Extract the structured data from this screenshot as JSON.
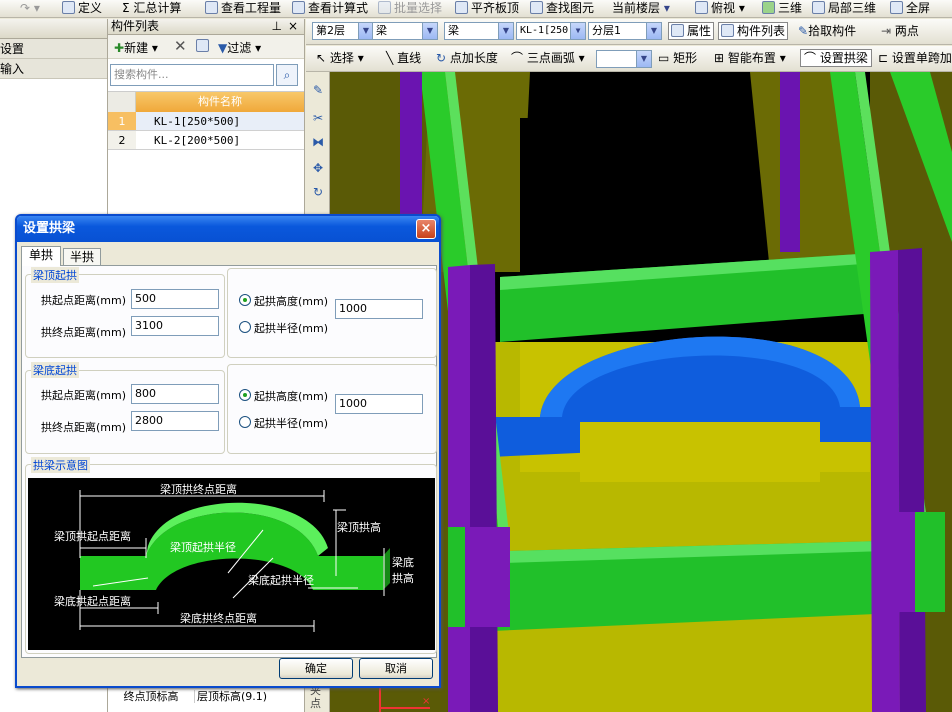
{
  "top_toolbar": {
    "items": [
      "定义",
      "Σ 汇总计算",
      "查看工程量",
      "查看计算式",
      "批量选择",
      "平齐板顶",
      "查找图元",
      "当前楼层",
      "俯视",
      "三维",
      "局部三维",
      "全屏"
    ]
  },
  "left_panel": {
    "items": [
      "设置",
      "输入"
    ]
  },
  "component_list": {
    "title": "构件列表",
    "pin": "ᵖ",
    "close": "×",
    "new_label": "新建",
    "filter_label": "过滤",
    "search_placeholder": "搜索构件...",
    "column_header": "构件名称",
    "rows": [
      {
        "num": "1",
        "name": "KL-1[250*500]"
      },
      {
        "num": "2",
        "name": "KL-2[200*500]"
      }
    ]
  },
  "selectors": {
    "floor": "第2层",
    "type1": "梁",
    "type2": "梁",
    "component": "KL-1[250",
    "layer": "分层1"
  },
  "toolbar2": {
    "properties": "属性",
    "component_list": "构件列表",
    "pick_component": "拾取构件",
    "two_points": "两点"
  },
  "toolbar3": {
    "select": "选择",
    "line": "直线",
    "point_length": "点加长度",
    "three_point_arc": "三点画弧",
    "rectangle": "矩形",
    "smart_layout": "智能布置",
    "set_arch_beam": "设置拱梁",
    "set_single_span": "设置单跨加"
  },
  "bottom_props": {
    "label": "终点顶标高",
    "value": "层顶标高(9.1)",
    "side_text": "夹点"
  },
  "dialog": {
    "title": "设置拱梁",
    "close": "×",
    "tabs": [
      "单拱",
      "半拱"
    ],
    "top_group": {
      "title": "梁顶起拱",
      "start_label": "拱起点距离(mm)",
      "start_value": "500",
      "end_label": "拱终点距离(mm)",
      "end_value": "3100",
      "height_label": "起拱高度(mm)",
      "radius_label": "起拱半径(mm)",
      "height_value": "1000"
    },
    "bottom_group": {
      "title": "梁底起拱",
      "start_label": "拱起点距离(mm)",
      "start_value": "800",
      "end_label": "拱终点距离(mm)",
      "end_value": "2800",
      "height_label": "起拱高度(mm)",
      "radius_label": "起拱半径(mm)",
      "height_value": "1000"
    },
    "diagram": {
      "title": "拱梁示意图",
      "labels": {
        "top_end": "梁顶拱终点距离",
        "top_start": "梁顶拱起点距离",
        "top_radius": "梁顶起拱半径",
        "top_height": "梁顶拱高",
        "bottom_radius": "梁底起拱半径",
        "bottom_height_1": "梁底",
        "bottom_height_2": "拱高",
        "bottom_start": "梁底拱起点距离",
        "bottom_end": "梁底拱终点距离"
      }
    },
    "ok": "确定",
    "cancel": "取消"
  }
}
